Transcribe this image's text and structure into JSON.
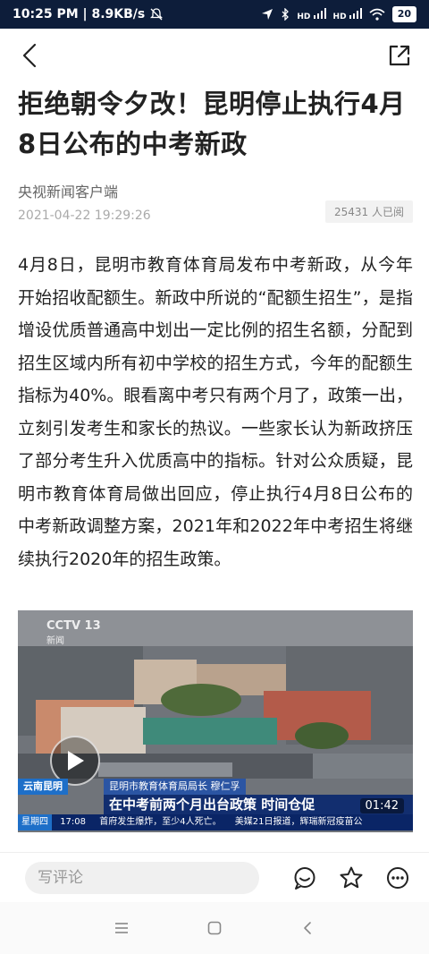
{
  "status_bar": {
    "time_speed": "10:25 PM | 8.9KB/s",
    "signal_1": "HD",
    "signal_2": "HD",
    "battery": "20"
  },
  "nav": {
    "back_icon": "back-arrow-icon",
    "share_icon": "share-external-icon"
  },
  "article": {
    "title": "拒绝朝令夕改！昆明停止执行4月8日公布的中考新政",
    "source": "央视新闻客户端",
    "date": "2021-04-22 19:29:26",
    "reads": "25431 人已阅",
    "body": "4月8日，昆明市教育体育局发布中考新政，从今年开始招收配额生。新政中所说的“配额生招生”，是指增设优质普通高中划出一定比例的招生名额，分配到招生区域内所有初中学校的招生方式，今年的配额生指标为40%。眼看离中考只有两个月了，政策一出，立刻引发考生和家长的热议。一些家长认为新政挤压了部分考生升入优质高中的指标。针对公众质疑，昆明市教育体育局做出回应，停止执行4月8日公布的中考新政调整方案，2021年和2022年中考招生将继续执行2020年的招生政策。"
  },
  "video": {
    "channel": "CCTV 13",
    "channel_sub": "新闻",
    "location_tag": "云南昆明",
    "speaker": "昆明市教育体育局局长 穆仁孚",
    "headline": "在中考前两个月出台政策 时间仓促",
    "ticker_day": "星期四",
    "ticker_time": "17:08",
    "ticker_text_1": "首府发生爆炸，至少4人死亡。",
    "ticker_text_2": "美媒21日报道，辉瑞新冠疫苗公",
    "duration": "01:42"
  },
  "bottom": {
    "comment_placeholder": "写评论",
    "icons": [
      "comment-bubble-icon",
      "favorite-star-icon",
      "more-options-icon"
    ]
  },
  "colors": {
    "status_bg": "#0d1d3a",
    "text": "#222222",
    "muted": "#888888",
    "cctv_blue": "#1e6fc8"
  }
}
